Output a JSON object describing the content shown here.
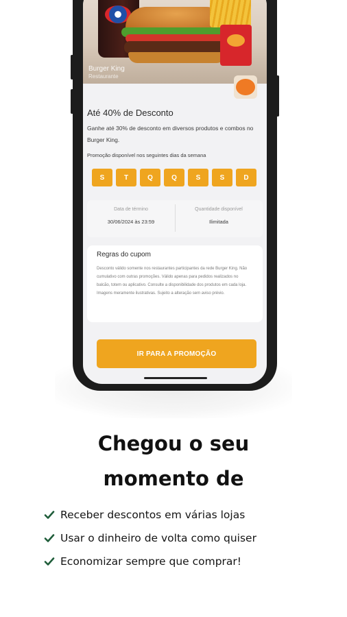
{
  "promo_card": {
    "hero_caption": "Burger King",
    "hero_subcaption": "Restaurante",
    "logo_text": "BURGER KING",
    "title": "Até 40% de Desconto",
    "description": "Ganhe até 30% de desconto em diversos produtos e combos no Burger King.",
    "availability_note": "Promoção disponível nos seguintes dias da semana",
    "days": [
      "S",
      "T",
      "Q",
      "Q",
      "S",
      "S",
      "D"
    ],
    "info": [
      {
        "label": "Data de término",
        "value": "30/06/2024 às 23:59"
      },
      {
        "label": "Quantidade disponível",
        "value": "Ilimitada"
      }
    ],
    "rules_title": "Regras do cupom",
    "rules_text": "Desconto válido somente nos restaurantes participantes da rede Burger King. Não cumulativo com outras promoções. Válido apenas para pedidos realizados no balcão, totem ou aplicativo. Consulte a disponibilidade dos produtos em cada loja. Imagens meramente ilustrativas. Sujeito a alteração sem aviso prévio.",
    "cta_label": "IR PARA A PROMOÇÃO"
  },
  "headline": {
    "line1": "Chegou o seu",
    "line2": "momento de"
  },
  "benefits": [
    "Receber descontos em várias lojas",
    "Usar o dinheiro de volta como quiser",
    "Economizar sempre que comprar!"
  ],
  "colors": {
    "accent": "#efa51f",
    "check": "#1f5d3a",
    "text": "#111111"
  }
}
